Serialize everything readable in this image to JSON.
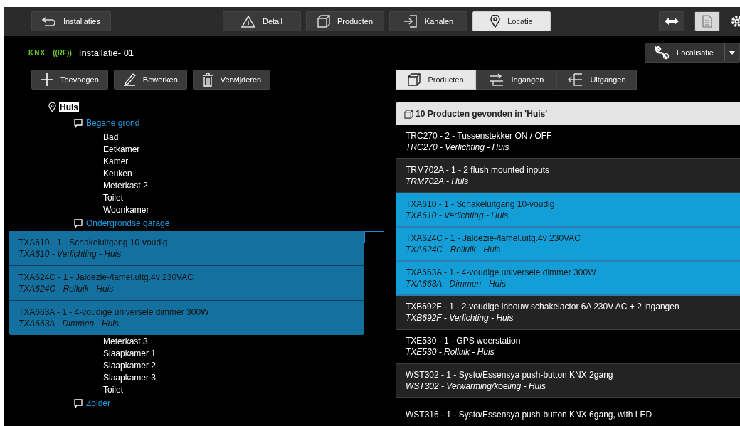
{
  "top_bar": {
    "back_button": "Installaties",
    "tabs": [
      {
        "label": "Detail",
        "selected": false
      },
      {
        "label": "Producten",
        "selected": false
      },
      {
        "label": "Kanalen",
        "selected": false
      },
      {
        "label": "Locatie",
        "selected": true
      }
    ]
  },
  "header": {
    "logo_knx": "KNX",
    "logo_rf": "((RF))",
    "title": "Installatie- 01",
    "menu_button": "Localisatie"
  },
  "toolbar": [
    "Toevoegen",
    "Bewerken",
    "Verwijderen"
  ],
  "view_tabs": [
    {
      "label": "Producten",
      "selected": true
    },
    {
      "label": "Ingangen",
      "selected": false
    },
    {
      "label": "Uitgangen",
      "selected": false
    }
  ],
  "tree": {
    "label": "Huis",
    "selected": true,
    "children": [
      {
        "label": "Begane grond",
        "children": [
          {
            "label": "Bad"
          },
          {
            "label": "Eetkamer"
          },
          {
            "label": "Kamer"
          },
          {
            "label": "Keuken"
          },
          {
            "label": "Meterkast 2"
          },
          {
            "label": "Toilet"
          },
          {
            "label": "Woonkamer"
          }
        ]
      },
      {
        "label": "Ondergrondse garage"
      },
      {
        "children": [
          {
            "label": "Meterkast 3"
          },
          {
            "label": "Slaapkamer 1"
          },
          {
            "label": "Slaapkamer 2"
          },
          {
            "label": "Slaapkamer 3"
          },
          {
            "label": "Toilet"
          }
        ]
      },
      {
        "label": "Zolder"
      }
    ]
  },
  "drag_preview": [
    {
      "title": "TXA610 - 1 - Schakeluitgang 10-voudig",
      "subtitle": "TXA610 - Verlichting - Huis"
    },
    {
      "title": "TXA624C - 1 - Jaloezie-/lamel.uitg.4v 230VAC",
      "subtitle": "TXA624C - Rolluik - Huis"
    },
    {
      "title": "TXA663A - 1 - 4-voudige universele dimmer 300W",
      "subtitle": "TXA663A - Dimmen - Huis"
    }
  ],
  "products": {
    "heading": "10 Producten gevonden in 'Huis'",
    "rows": [
      {
        "title": "TRC270 - 2 - Tussenstekker ON / OFF",
        "subtitle": "TRC270 - Verlichting - Huis",
        "selected": false
      },
      {
        "title": "TRM702A - 1 - 2 flush mounted inputs",
        "subtitle": "TRM702A - Huis",
        "selected": false
      },
      {
        "title": "TXA610 - 1 - Schakeluitgang 10-voudig",
        "subtitle": "TXA610 - Verlichting - Huis",
        "selected": true
      },
      {
        "title": "TXA624C - 1 - Jaloezie-/lamel.uitg.4v 230VAC",
        "subtitle": "TXA624C - Rolluik - Huis",
        "selected": true
      },
      {
        "title": "TXA663A - 1 - 4-voudige universele dimmer 300W",
        "subtitle": "TXA663A - Dimmen - Huis",
        "selected": true
      },
      {
        "title": "TXB692F - 1 - 2-voudige inbouw schakelactor 6A 230V AC + 2 ingangen",
        "subtitle": "TXB692F - Verlichting - Huis",
        "selected": false
      },
      {
        "title": "TXE530 - 1 - GPS weerstation",
        "subtitle": "TXE530 - Rolluik - Huis",
        "selected": false
      },
      {
        "title": "WST302 - 1 - Systo/Essensya push-button KNX 2gang",
        "subtitle": "WST302 - Verwarming/koeling - Huis",
        "selected": false
      },
      {
        "title": "WST316 - 1 - Systo/Essensya push-button KNX 6gang, with LED",
        "selected": false
      }
    ]
  }
}
